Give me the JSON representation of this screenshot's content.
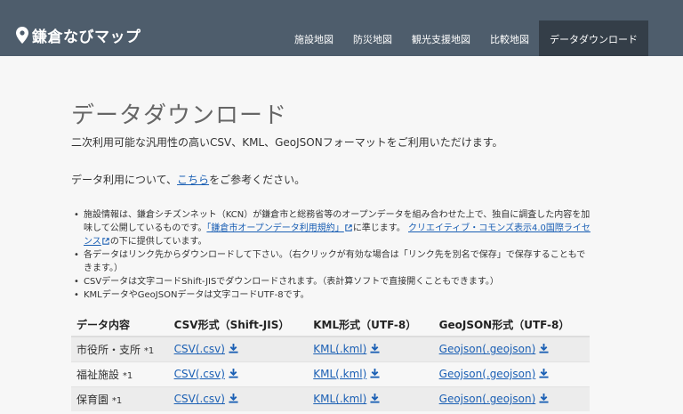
{
  "navbar": {
    "brand": "鎌倉なびマップ",
    "items": [
      {
        "label": "施設地図"
      },
      {
        "label": "防災地図"
      },
      {
        "label": "観光支援地図"
      },
      {
        "label": "比較地図"
      },
      {
        "label": "データダウンロード",
        "active": true
      }
    ]
  },
  "page": {
    "title": "データダウンロード",
    "lead": "二次利用可能な汎用性の高いCSV、KML、GeoJSONフォーマットをご利用いただけます。",
    "ref_prefix": "データ利用について、",
    "ref_link": "こちら",
    "ref_suffix": "をご参考ください。"
  },
  "notes": {
    "n1_a": "施設情報は、鎌倉シチズンネット（KCN）が鎌倉市と総務省等のオープンデータを組み合わせた上で、独自に調査した内容を加味して公開しているものです。",
    "n1_link1": "「鎌倉市オープンデータ利用規約」",
    "n1_b": "に準じます。",
    "n1_link2": "クリエイティブ・コモンズ表示4.0国際ライセンス",
    "n1_c": "の下に提供しています。",
    "n2": "各データはリンク先からダウンロードして下さい。（右クリックが有効な場合は「リンク先を別名で保存」で保存することもできます。）",
    "n3": "CSVデータは文字コードShift-JISでダウンロードされます。（表計算ソフトで直接開くこともできます。）",
    "n4": "KMLデータやGeoJSONデータは文字コードUTF-8です。"
  },
  "table": {
    "headers": [
      "データ内容",
      "CSV形式（Shift-JIS）",
      "KML形式（UTF-8）",
      "GeoJSON形式（UTF-8）"
    ],
    "rows": [
      {
        "name": "市役所・支所",
        "note": "*1",
        "csv": "CSV(.csv)",
        "kml": "KML(.kml)",
        "geojson": "Geojson(.geojson)"
      },
      {
        "name": "福祉施設",
        "note": "*1",
        "csv": "CSV(.csv)",
        "kml": "KML(.kml)",
        "geojson": "Geojson(.geojson)"
      },
      {
        "name": "保育園",
        "note": "*1",
        "csv": "CSV(.csv)",
        "kml": "KML(.kml)",
        "geojson": "Geojson(.geojson)"
      }
    ]
  },
  "colors": {
    "navbar": "#4e5d6c",
    "navbar_active": "#343e48",
    "link": "#1a5fb4"
  }
}
